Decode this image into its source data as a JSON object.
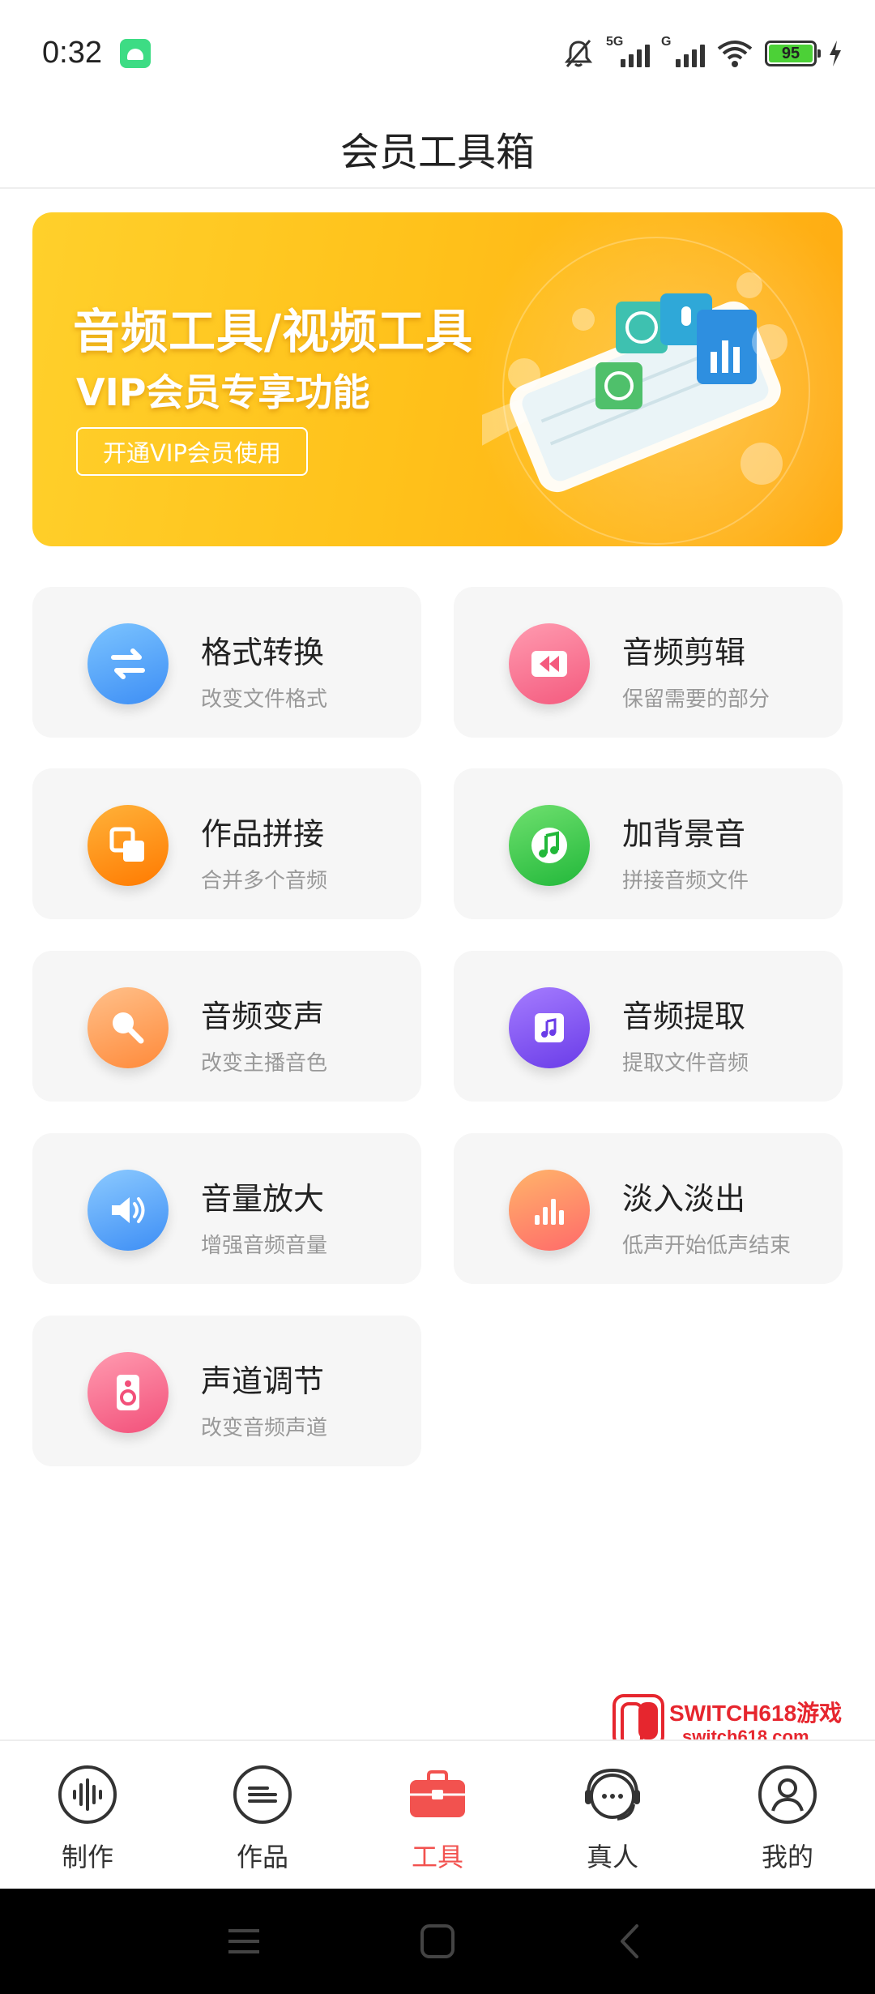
{
  "status_bar": {
    "time": "0:32",
    "signal1_label": "5G",
    "signal2_label": "G",
    "battery": "95"
  },
  "header": {
    "title": "会员工具箱"
  },
  "banner": {
    "title": "音频工具/视频工具",
    "subtitle": "VIP会员专享功能",
    "button_label": "开通VIP会员使用"
  },
  "tools": [
    {
      "title": "格式转换",
      "desc": "改变文件格式",
      "icon": "convert-icon",
      "color": "#4aa3ff"
    },
    {
      "title": "音频剪辑",
      "desc": "保留需要的部分",
      "icon": "rewind-icon",
      "color": "#ff6b8b"
    },
    {
      "title": "作品拼接",
      "desc": "合并多个音频",
      "icon": "merge-icon",
      "color": "#ff9a12"
    },
    {
      "title": "加背景音",
      "desc": "拼接音频文件",
      "icon": "music-note-icon",
      "color": "#3fd24b"
    },
    {
      "title": "音频变声",
      "desc": "改变主播音色",
      "icon": "microphone-icon",
      "color": "#ff9a4a"
    },
    {
      "title": "音频提取",
      "desc": "提取文件音频",
      "icon": "music-file-icon",
      "color": "#8a5cf5"
    },
    {
      "title": "音量放大",
      "desc": "增强音频音量",
      "icon": "speaker-icon",
      "color": "#4aa3ff"
    },
    {
      "title": "淡入淡出",
      "desc": "低声开始低声结束",
      "icon": "fade-bars-icon",
      "color": "#ff8a5a"
    },
    {
      "title": "声道调节",
      "desc": "改变音频声道",
      "icon": "speaker-box-icon",
      "color": "#ff6b8b"
    }
  ],
  "watermark": {
    "line1": "SWITCH618游戏",
    "line2": "switch618.com"
  },
  "bottom_nav": [
    {
      "label": "制作",
      "icon": "waveform-icon",
      "active": false
    },
    {
      "label": "作品",
      "icon": "list-icon",
      "active": false
    },
    {
      "label": "工具",
      "icon": "toolbox-icon",
      "active": true
    },
    {
      "label": "真人",
      "icon": "headset-icon",
      "active": false
    },
    {
      "label": "我的",
      "icon": "profile-icon",
      "active": false
    }
  ],
  "colors": {
    "accent": "#f2524f",
    "banner": "#ffc21b"
  }
}
